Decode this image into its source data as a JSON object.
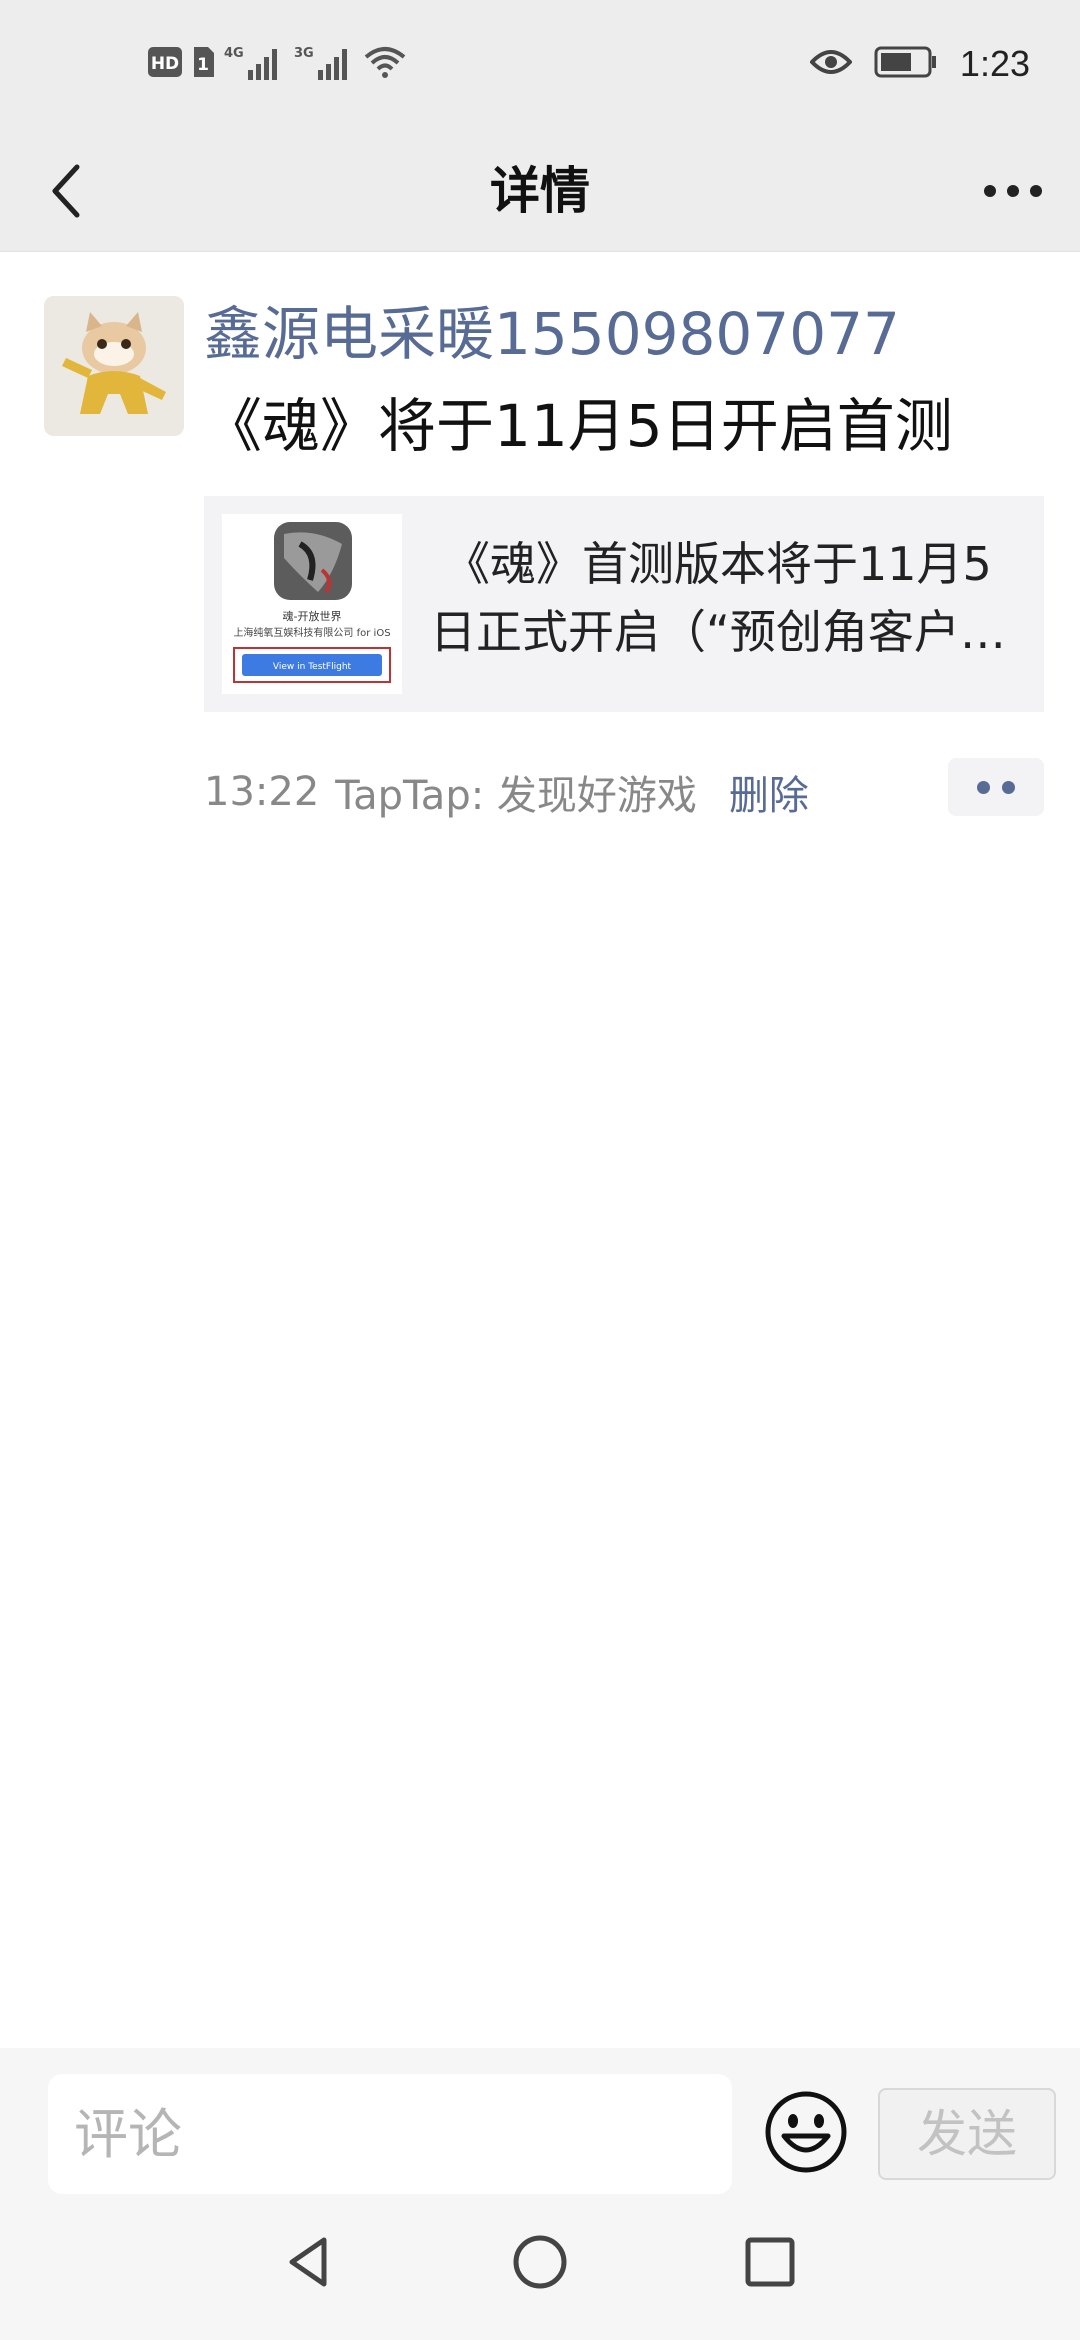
{
  "status_bar": {
    "left_indicators": [
      "HD",
      "1",
      "4G",
      "3G"
    ],
    "icons": [
      "hd-icon",
      "sim-1-icon",
      "signal-4g-icon",
      "signal-3g-icon",
      "wifi-icon",
      "eye-icon",
      "battery-icon"
    ],
    "time": "1:23"
  },
  "nav": {
    "title": "详情",
    "back_icon": "back-chevron-icon",
    "more_icon": "more-dots-icon"
  },
  "post": {
    "avatar_icon": "cat-avatar",
    "username": "鑫源电采暖15509807077",
    "text": "《魂》将于11月5日开启首测",
    "link_card": {
      "thumbnail": {
        "app_name": "魂-开放世界",
        "developer": "上海纯氧互娱科技有限公司 for iOS",
        "button_label": "View in TestFlight"
      },
      "title_line1": "《魂》首测版本将于11月5",
      "title_line2": "日正式开启（“预创角客户…"
    },
    "time": "13:22",
    "source": "TapTap: 发现好游戏",
    "delete_label": "删除",
    "action_icon": "comment-like-dots-icon"
  },
  "composer": {
    "placeholder": "评论",
    "value": "",
    "emoji_icon": "emoji-icon",
    "send_label": "发送"
  },
  "system_nav": {
    "icons": [
      "nav-back-icon",
      "nav-home-icon",
      "nav-recents-icon"
    ]
  },
  "colors": {
    "link_blue": "#576b95",
    "header_bg": "#ededed",
    "card_bg": "#f3f3f5",
    "bottom_bg": "#f6f6f6"
  }
}
